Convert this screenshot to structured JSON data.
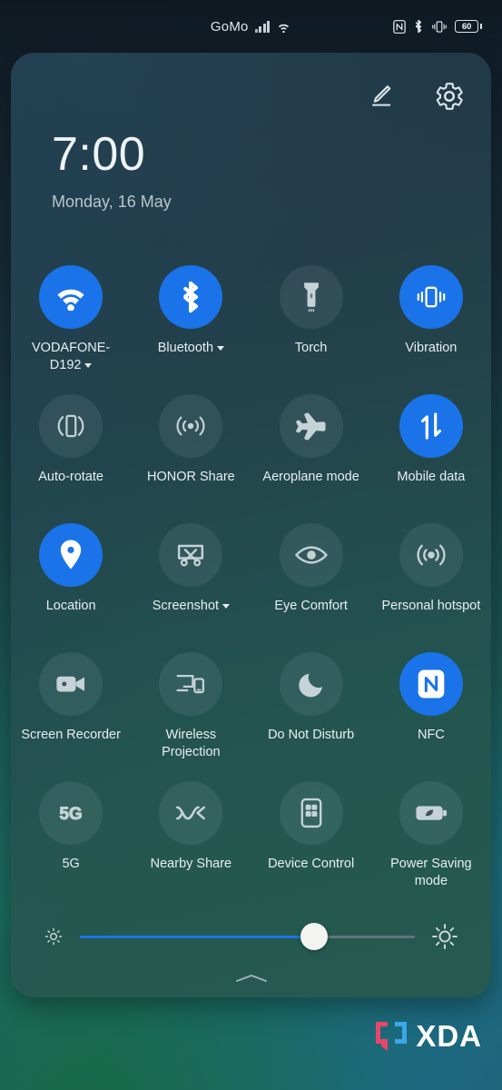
{
  "status_bar": {
    "carrier": "GoMo",
    "signal_icon": "signal-bars-icon",
    "wifi_icon": "wifi-icon",
    "nfc_icon": "nfc-icon",
    "bluetooth_icon": "bluetooth-icon",
    "vibrate_icon": "vibrate-icon",
    "battery_level": "60",
    "battery_icon": "battery-icon"
  },
  "panel": {
    "edit_label": "edit-icon",
    "settings_label": "settings-gear-icon",
    "clock": "7:00",
    "date": "Monday, 16 May",
    "active_color": "#1a73e8",
    "inactive_color": "rgba(216,233,240,0.085)"
  },
  "tiles": [
    {
      "name": "wifi",
      "label": "VODAFONE-D192",
      "icon": "wifi-icon",
      "active": true,
      "caret": true
    },
    {
      "name": "bluetooth",
      "label": "Bluetooth",
      "icon": "bluetooth-icon",
      "active": true,
      "caret": true
    },
    {
      "name": "torch",
      "label": "Torch",
      "icon": "flashlight-icon",
      "active": false,
      "caret": false
    },
    {
      "name": "vibration",
      "label": "Vibration",
      "icon": "vibration-icon",
      "active": true,
      "caret": false
    },
    {
      "name": "auto-rotate",
      "label": "Auto-rotate",
      "icon": "auto-rotate-icon",
      "active": false,
      "caret": false
    },
    {
      "name": "honor-share",
      "label": "HONOR Share",
      "icon": "honor-share-icon",
      "active": false,
      "caret": false
    },
    {
      "name": "aeroplane-mode",
      "label": "Aeroplane mode",
      "icon": "airplane-icon",
      "active": false,
      "caret": false
    },
    {
      "name": "mobile-data",
      "label": "Mobile data",
      "icon": "mobile-data-icon",
      "active": true,
      "caret": false
    },
    {
      "name": "location",
      "label": "Location",
      "icon": "location-pin-icon",
      "active": true,
      "caret": false
    },
    {
      "name": "screenshot",
      "label": "Screenshot",
      "icon": "screenshot-icon",
      "active": false,
      "caret": true
    },
    {
      "name": "eye-comfort",
      "label": "Eye Comfort",
      "icon": "eye-icon",
      "active": false,
      "caret": false
    },
    {
      "name": "personal-hotspot",
      "label": "Personal hotspot",
      "icon": "hotspot-icon",
      "active": false,
      "caret": false
    },
    {
      "name": "screen-recorder",
      "label": "Screen Recorder",
      "icon": "video-camera-icon",
      "active": false,
      "caret": false
    },
    {
      "name": "wireless-projection",
      "label": "Wireless Projection",
      "icon": "wireless-projection-icon",
      "active": false,
      "caret": false
    },
    {
      "name": "do-not-disturb",
      "label": "Do Not Disturb",
      "icon": "moon-icon",
      "active": false,
      "caret": false
    },
    {
      "name": "nfc",
      "label": "NFC",
      "icon": "nfc-icon",
      "active": true,
      "caret": false
    },
    {
      "name": "5g",
      "label": "5G",
      "icon": "5g-icon",
      "active": false,
      "caret": false
    },
    {
      "name": "nearby-share",
      "label": "Nearby Share",
      "icon": "nearby-share-icon",
      "active": false,
      "caret": false
    },
    {
      "name": "device-control",
      "label": "Device Control",
      "icon": "device-control-icon",
      "active": false,
      "caret": false
    },
    {
      "name": "power-saving-mode",
      "label": "Power Saving mode",
      "icon": "power-saving-icon",
      "active": false,
      "caret": false
    }
  ],
  "brightness": {
    "low_icon": "brightness-low-icon",
    "high_icon": "brightness-high-icon",
    "value_percent": 70
  },
  "handle": {
    "icon": "chevron-up-handle-icon"
  },
  "watermark": {
    "text": "XDA",
    "bracket_left_color": "#e8456b",
    "bracket_right_color": "#3ba7e8"
  }
}
